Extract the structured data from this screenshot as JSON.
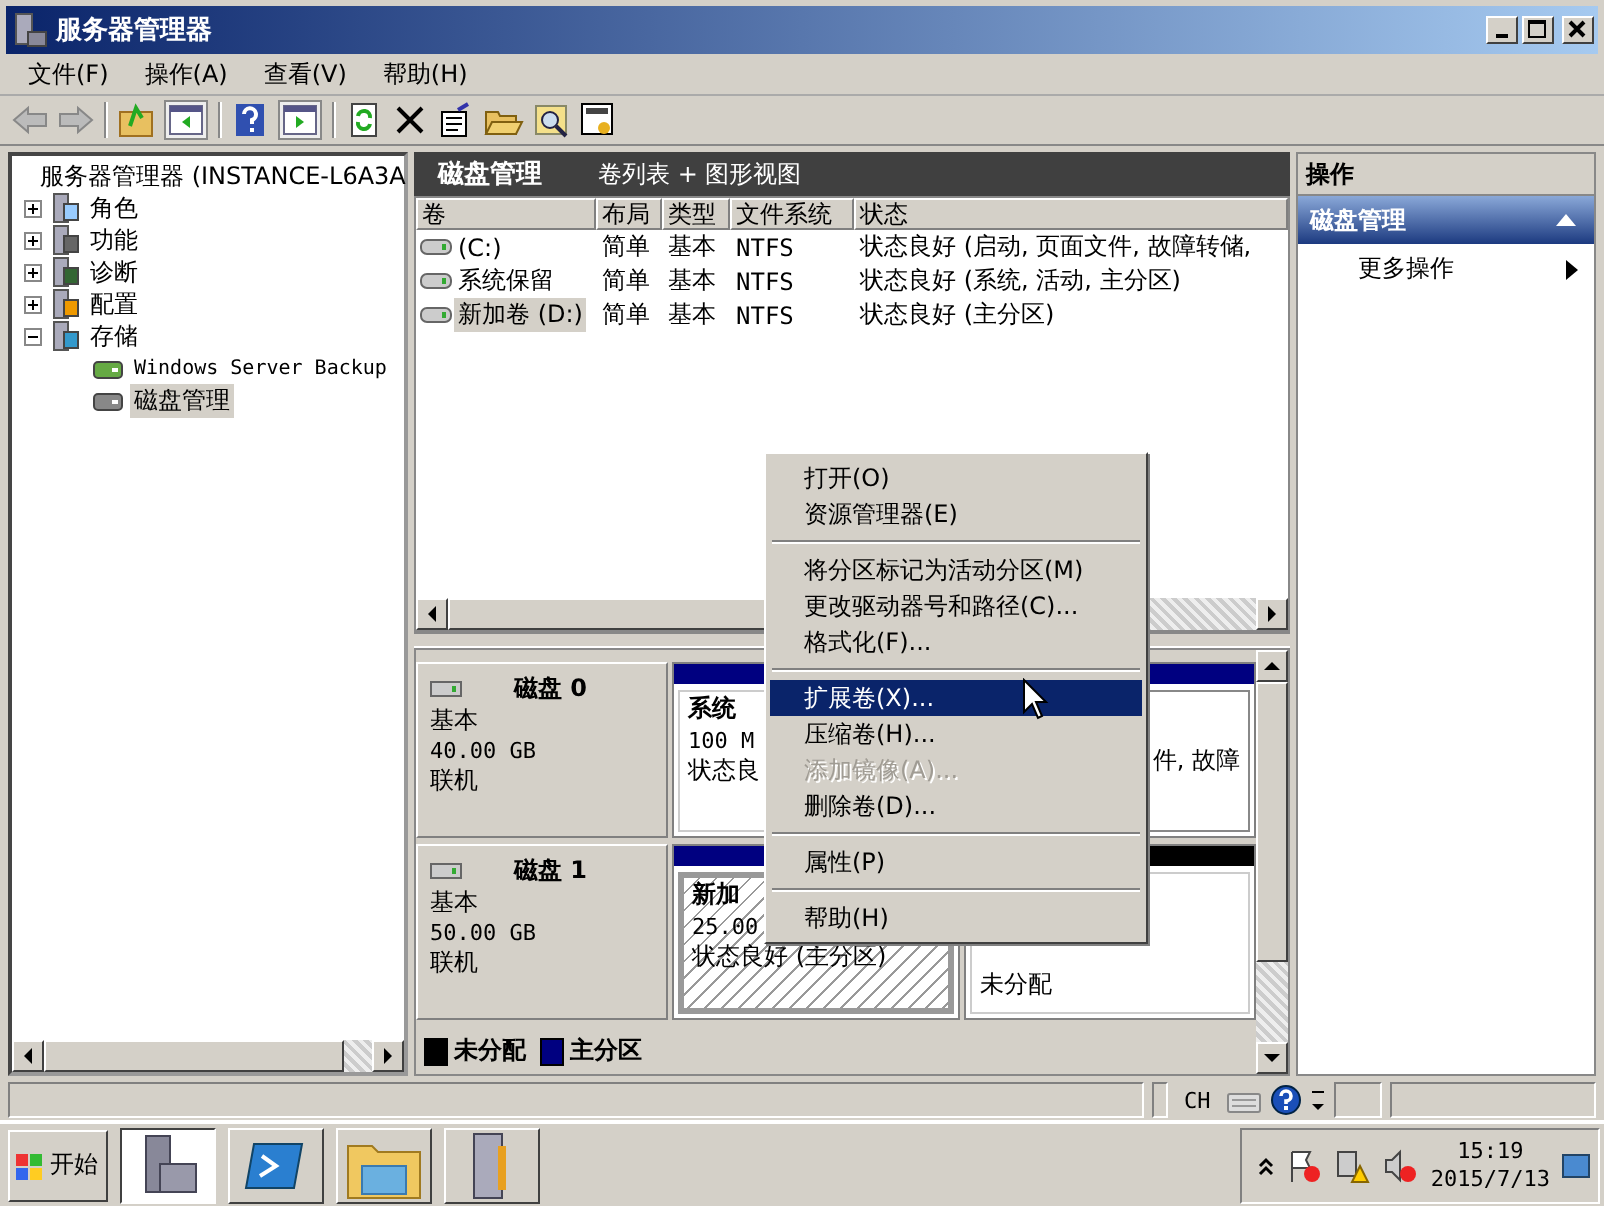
{
  "window": {
    "title": "服务器管理器"
  },
  "menu_bar": [
    "文件(F)",
    "操作(A)",
    "查看(V)",
    "帮助(H)"
  ],
  "tree": {
    "label": "服务器管理器 (INSTANCE-L6A3A",
    "children": [
      {
        "label": "角色",
        "expanded": false,
        "selected": false
      },
      {
        "label": "功能",
        "expanded": false,
        "selected": false
      },
      {
        "label": "诊断",
        "expanded": false,
        "selected": false
      },
      {
        "label": "配置",
        "expanded": false,
        "selected": false
      },
      {
        "label": "存储",
        "expanded": true,
        "selected": false,
        "children": [
          {
            "label": "Windows Server Backup",
            "selected": false
          },
          {
            "label": "磁盘管理",
            "selected": true
          }
        ]
      }
    ]
  },
  "header": {
    "title": "磁盘管理",
    "subtitle": "卷列表 + 图形视图"
  },
  "volume_table": {
    "columns": [
      "卷",
      "布局",
      "类型",
      "文件系统",
      "状态"
    ],
    "rows": [
      {
        "selected": false,
        "cells": [
          "(C:)",
          "简单",
          "基本",
          "NTFS",
          "状态良好 (启动, 页面文件, 故障转储,"
        ]
      },
      {
        "selected": false,
        "cells": [
          "系统保留",
          "简单",
          "基本",
          "NTFS",
          "状态良好 (系统, 活动, 主分区)"
        ]
      },
      {
        "selected": true,
        "cells": [
          "新加卷 (D:)",
          "简单",
          "基本",
          "NTFS",
          "状态良好 (主分区)"
        ]
      }
    ]
  },
  "disks": [
    {
      "name": "磁盘 0",
      "type": "基本",
      "size": "40.00 GB",
      "status": "联机",
      "partitions": [
        {
          "kind": "primary",
          "title": "系统",
          "lines": [
            "100 M",
            "状态良"
          ]
        },
        {
          "kind": "primary",
          "lines": [
            "件, 故障"
          ]
        }
      ]
    },
    {
      "name": "磁盘 1",
      "type": "基本",
      "size": "50.00 GB",
      "status": "联机",
      "partitions": [
        {
          "kind": "primary",
          "title": "新加",
          "lines": [
            "25.00",
            "状态良好 (主分区)"
          ]
        },
        {
          "kind": "unallocated",
          "lines": [
            "未分配"
          ]
        }
      ]
    }
  ],
  "legend": [
    {
      "label": "未分配",
      "color": "#000000"
    },
    {
      "label": "主分区",
      "color": "#000080"
    }
  ],
  "context_menu": [
    {
      "kind": "item",
      "label": "打开(O)",
      "disabled": false,
      "selected": false
    },
    {
      "kind": "item",
      "label": "资源管理器(E)",
      "disabled": false,
      "selected": false
    },
    {
      "kind": "separator"
    },
    {
      "kind": "item",
      "label": "将分区标记为活动分区(M)",
      "disabled": false,
      "selected": false
    },
    {
      "kind": "item",
      "label": "更改驱动器号和路径(C)...",
      "disabled": false,
      "selected": false
    },
    {
      "kind": "item",
      "label": "格式化(F)...",
      "disabled": false,
      "selected": false
    },
    {
      "kind": "separator"
    },
    {
      "kind": "item",
      "label": "扩展卷(X)...",
      "disabled": false,
      "selected": true
    },
    {
      "kind": "item",
      "label": "压缩卷(H)...",
      "disabled": false,
      "selected": false
    },
    {
      "kind": "item",
      "label": "添加镜像(A)...",
      "disabled": true,
      "selected": false
    },
    {
      "kind": "item",
      "label": "删除卷(D)...",
      "disabled": false,
      "selected": false
    },
    {
      "kind": "separator"
    },
    {
      "kind": "item",
      "label": "属性(P)",
      "disabled": false,
      "selected": false
    },
    {
      "kind": "separator"
    },
    {
      "kind": "item",
      "label": "帮助(H)",
      "disabled": false,
      "selected": false
    }
  ],
  "actions": {
    "title": "操作",
    "section": "磁盘管理",
    "items": [
      "更多操作"
    ]
  },
  "status_bar": {
    "language": "CH"
  },
  "taskbar": {
    "start": "开始",
    "time": "15:19",
    "date": "2015/7/13"
  }
}
